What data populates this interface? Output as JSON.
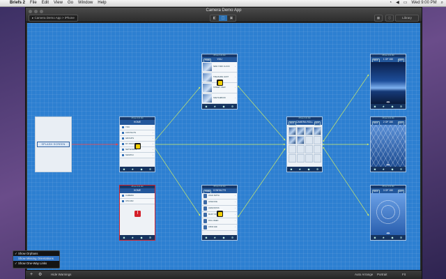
{
  "menubar": {
    "apple": "",
    "items": [
      "Briefs 2",
      "File",
      "Edit",
      "View",
      "Go",
      "Window",
      "Help"
    ],
    "clock": "Wed 9:00 PM",
    "status_icons": [
      "wifi-icon",
      "volume-icon",
      "battery-icon",
      "spotlight-icon"
    ]
  },
  "window": {
    "title": "Camera Demo App",
    "breadcrumb": "Camera Demo App  >  iPhone",
    "library_label": "Library",
    "view_toggle": [
      "◧",
      "⬚",
      "▣"
    ]
  },
  "canvas": {
    "splash_label": "SPLASH SCREEN",
    "screens": {
      "home": {
        "title": "HOME",
        "menu": [
          "YOU",
          "CONTACTS",
          "GROUPS",
          "MY PROFILE",
          "NETWORKS",
          "SEARCH"
        ]
      },
      "home_alt": {
        "title": "HOME",
        "menu": [
          "CAMERA",
          "UPLOAD"
        ]
      },
      "you": {
        "title": "YOU",
        "back": "HOME",
        "rows": [
          "NEW YORK CLOCK",
          "TREASURE HUNT",
          "STREET VIEW",
          "SKETCHBOOK"
        ]
      },
      "contacts": {
        "title": "CONTACTS",
        "back": "HOME",
        "rows": [
          "JOHN SMITH",
          "JANE DOE",
          "ADAM ROSS",
          "MARY KING",
          "PAUL REED",
          "ANNA LEE"
        ]
      },
      "cameraroll": {
        "title": "CAMERA ROLL",
        "back": "BACK",
        "right": "EDIT"
      },
      "photo1": {
        "title": "1 OF 150",
        "back": "BACK",
        "right": "EDIT"
      },
      "photo2": {
        "title": "2 OF 150",
        "back": "BACK",
        "right": "EDIT"
      },
      "photo3": {
        "title": "3 OF 150",
        "back": "BACK",
        "right": "EDIT"
      }
    },
    "status_text": "iPhone 9:41 AM"
  },
  "options_popup": {
    "items": [
      {
        "label": "Show Orphans",
        "checked": true
      },
      {
        "label": "Show Missing Orientations",
        "checked": false
      },
      {
        "label": "Show One-Way Links",
        "checked": true
      }
    ]
  },
  "bottombar": {
    "add": "+",
    "settings": "⚙",
    "hide_warnings": "Hide Warnings",
    "auto_arrange": "Auto Arrange",
    "orientation": "Portrait",
    "fit": "Fit"
  }
}
